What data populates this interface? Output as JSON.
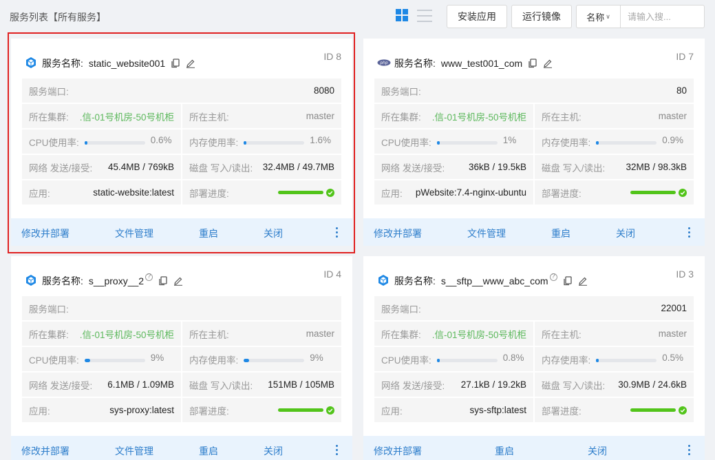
{
  "header": {
    "title": "服务列表【所有服务】",
    "install_app": "安装应用",
    "run_image": "运行镜像",
    "search_type": "名称",
    "search_placeholder": "请输入搜..."
  },
  "labels": {
    "service_name": "服务名称:",
    "port": "服务端口:",
    "cluster": "所在集群:",
    "host": "所在主机:",
    "cpu": "CPU使用率:",
    "mem": "内存使用率:",
    "net": "网络 发送/接受:",
    "disk": "磁盘 写入/读出:",
    "app": "应用:",
    "deploy": "部署进度:"
  },
  "cards": [
    {
      "name": "static_website001",
      "id": "ID 8",
      "icon": "cube-icon",
      "port": "8080",
      "cluster": ".信-01号机房-50号机柜",
      "host": "master",
      "cpu_pct": "0.6%",
      "cpu_val": 0.006,
      "mem_pct": "1.6%",
      "mem_val": 0.016,
      "net": "45.4MB / 769kB",
      "disk": "32.4MB / 49.7MB",
      "app": "static-website:latest",
      "deploy_progress": 1.0,
      "actions": [
        "修改并部署",
        "文件管理",
        "重启",
        "关闭"
      ]
    },
    {
      "name": "www_test001_com",
      "id": "ID 7",
      "icon": "php-icon",
      "port": "80",
      "cluster": ".信-01号机房-50号机柜",
      "host": "master",
      "cpu_pct": "1%",
      "cpu_val": 0.01,
      "mem_pct": "0.9%",
      "mem_val": 0.009,
      "net": "36kB / 19.5kB",
      "disk": "32MB / 98.3kB",
      "app": "pWebsite:7.4-nginx-ubuntu",
      "deploy_progress": 1.0,
      "actions": [
        "修改并部署",
        "文件管理",
        "重启",
        "关闭"
      ]
    },
    {
      "name": "s__proxy__2",
      "id": "ID 4",
      "icon": "cube-icon",
      "port": "",
      "cluster": ".信-01号机房-50号机柜",
      "host": "master",
      "cpu_pct": "9%",
      "cpu_val": 0.09,
      "mem_pct": "9%",
      "mem_val": 0.09,
      "net": "6.1MB / 1.09MB",
      "disk": "151MB / 105MB",
      "app": "sys-proxy:latest",
      "deploy_progress": 1.0,
      "actions": [
        "修改并部署",
        "文件管理",
        "重启",
        "关闭"
      ]
    },
    {
      "name": "s__sftp__www_abc_com",
      "id": "ID 3",
      "icon": "cube-icon",
      "port": "22001",
      "cluster": ".信-01号机房-50号机柜",
      "host": "master",
      "cpu_pct": "0.8%",
      "cpu_val": 0.008,
      "mem_pct": "0.5%",
      "mem_val": 0.005,
      "net": "27.1kB / 19.2kB",
      "disk": "30.9MB / 24.6kB",
      "app": "sys-sftp:latest",
      "deploy_progress": 1.0,
      "actions": [
        "修改并部署",
        "重启",
        "关闭"
      ]
    }
  ],
  "colors": {
    "accent": "#1e88e5",
    "link": "#2e7ecb",
    "success": "#52c41a",
    "cluster_text": "#5cb85c",
    "selection": "#e02020",
    "footer_bg": "#e9f3fd"
  }
}
